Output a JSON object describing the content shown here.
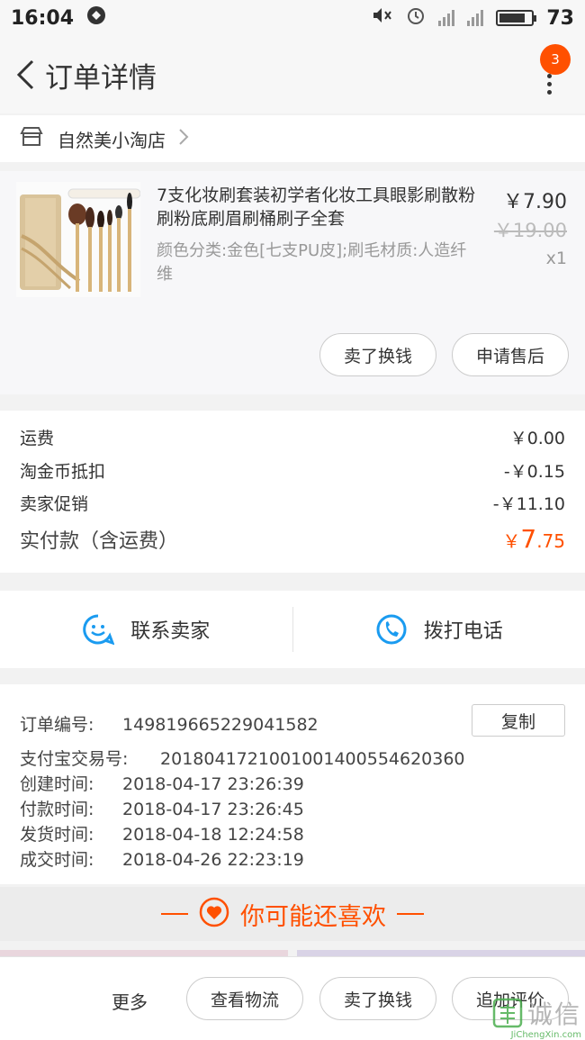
{
  "status_bar": {
    "time": "16:04",
    "battery": "73",
    "network": "4G"
  },
  "header": {
    "title": "订单详情",
    "badge_count": "3"
  },
  "shop": {
    "name": "自然美小淘店"
  },
  "product": {
    "title": "7支化妆刷套装初学者化妆工具眼影刷散粉刷粉底刷眉刷桶刷子全套",
    "attributes": "颜色分类:金色[七支PU皮];刷毛材质:人造纤维",
    "price": "￥7.90",
    "original_price": "￥19.00",
    "quantity": "x1",
    "buttons": {
      "sell": "卖了换钱",
      "after_sale": "申请售后"
    }
  },
  "fees": {
    "shipping_label": "运费",
    "shipping_value": "￥0.00",
    "coin_label": "淘金币抵扣",
    "coin_value": "-￥0.15",
    "promo_label": "卖家促销",
    "promo_value": "-￥11.10",
    "total_label": "实付款（含运费）",
    "total_currency": "￥",
    "total_int": "7",
    "total_dec": ".75"
  },
  "contact": {
    "seller": "联系卖家",
    "phone": "拨打电话"
  },
  "order_info": {
    "copy_label": "复制",
    "rows": [
      {
        "label": "订单编号:",
        "value": "149819665229041582"
      },
      {
        "label": "支付宝交易号:",
        "value": "2018041721001001400554620360"
      },
      {
        "label": "创建时间:",
        "value": "2018-04-17 23:26:39"
      },
      {
        "label": "付款时间:",
        "value": "2018-04-17 23:26:45"
      },
      {
        "label": "发货时间:",
        "value": "2018-04-18 12:24:58"
      },
      {
        "label": "成交时间:",
        "value": "2018-04-26 22:23:19"
      }
    ]
  },
  "recommend": {
    "title": "你可能还喜欢"
  },
  "bottom_bar": {
    "more": "更多",
    "logistics": "查看物流",
    "sell": "卖了换钱",
    "review": "追加评价"
  },
  "watermark": {
    "text": "诚信",
    "sub": "JiChengXin.com"
  },
  "colors": {
    "accent": "#ff5000",
    "link_blue": "#1a9bf0"
  }
}
